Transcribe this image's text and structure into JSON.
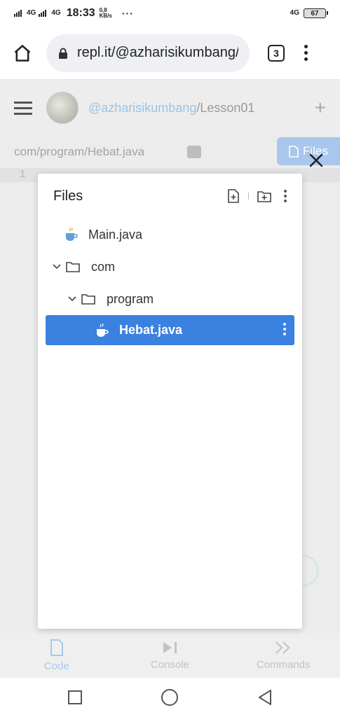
{
  "status_bar": {
    "net1": "4G",
    "net2": "4G",
    "time": "18:33",
    "speed_value": "0,8",
    "speed_unit": "KB/s",
    "more": "···",
    "net_right": "4G",
    "battery": "67"
  },
  "browser": {
    "url": "repl.it/@azharisikumbang/",
    "tab_count": "3"
  },
  "app_header": {
    "user": "@azharisikumbang",
    "separator": "/",
    "project": "Lesson01",
    "plus": "+"
  },
  "editor": {
    "file_tab": "com/program/Hebat.java",
    "files_tab": "Files",
    "line_number": "1"
  },
  "files_panel": {
    "title": "Files",
    "items": [
      {
        "label": "Main.java"
      },
      {
        "label": "com"
      },
      {
        "label": "program"
      },
      {
        "label": "Hebat.java"
      }
    ]
  },
  "bottom_nav": {
    "code": "Code",
    "console": "Console",
    "commands": "Commands"
  },
  "colors": {
    "accent": "#3a81e0",
    "link": "#9cc3e6"
  }
}
